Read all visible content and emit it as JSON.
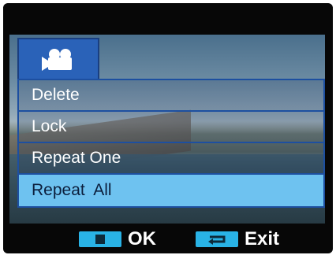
{
  "mode_tab": {
    "icon": "movie-camera-icon"
  },
  "menu": {
    "items": [
      {
        "label": "Delete",
        "selected": false
      },
      {
        "label": "Lock",
        "selected": false
      },
      {
        "label": "Repeat One",
        "selected": false
      },
      {
        "label": "Repeat  All",
        "selected": true
      }
    ]
  },
  "footer": {
    "ok_label": "OK",
    "exit_label": "Exit"
  },
  "colors": {
    "highlight": "#6ec2f0",
    "menu_border": "#1d4fa0",
    "tab": "#2a62b8",
    "key": "#29b3e6"
  }
}
